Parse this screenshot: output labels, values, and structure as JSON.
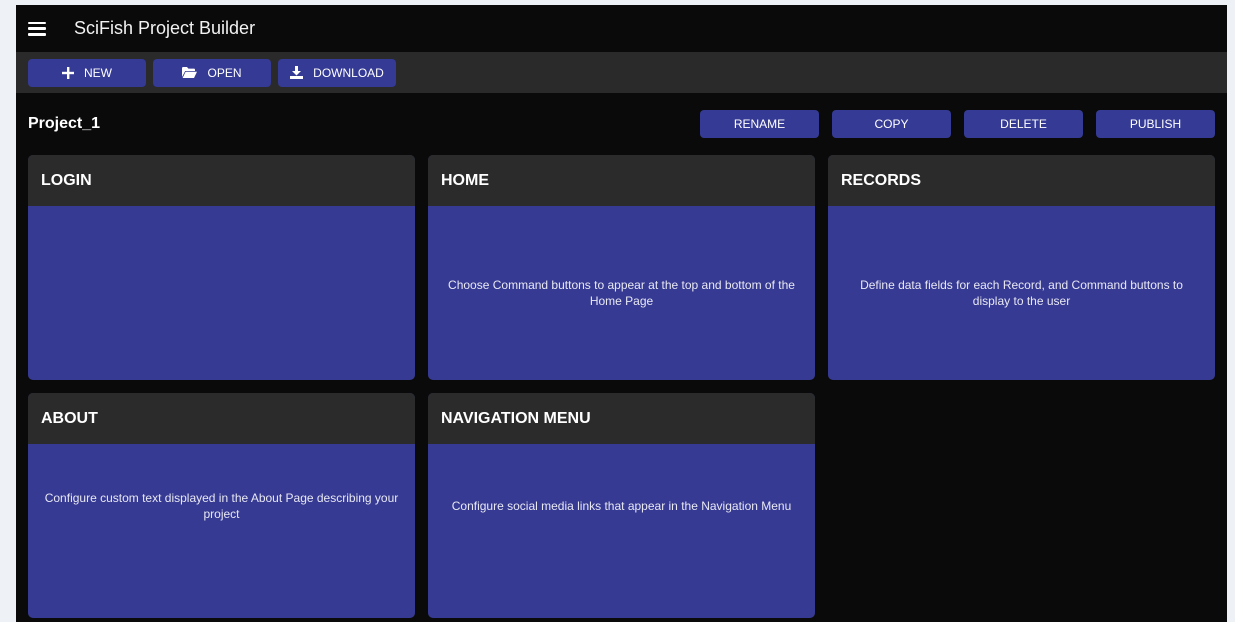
{
  "app": {
    "title": "SciFish Project Builder"
  },
  "toolbar": {
    "new_label": "NEW",
    "open_label": "OPEN",
    "download_label": "DOWNLOAD"
  },
  "project": {
    "name": "Project_1",
    "actions": {
      "rename": "RENAME",
      "copy": "COPY",
      "delete": "DELETE",
      "publish": "PUBLISH"
    }
  },
  "cards": [
    {
      "title": "LOGIN",
      "description": ""
    },
    {
      "title": "HOME",
      "description": "Choose Command buttons to appear at the top and bottom of the Home Page"
    },
    {
      "title": "RECORDS",
      "description": "Define data fields for each Record, and Command buttons to display to the user"
    },
    {
      "title": "ABOUT",
      "description": "Configure custom text displayed in the About Page describing your project"
    },
    {
      "title": "NAVIGATION MENU",
      "description": "Configure social media links that appear in the Navigation Menu"
    }
  ],
  "icons": {
    "menu": "hamburger-icon",
    "new": "plus-icon",
    "open": "folder-icon",
    "download": "download-icon"
  },
  "colors": {
    "background": "#0a0a0a",
    "accent": "#363a92",
    "toolbar": "#2a2a2a",
    "card_header": "#2b2b2b"
  }
}
